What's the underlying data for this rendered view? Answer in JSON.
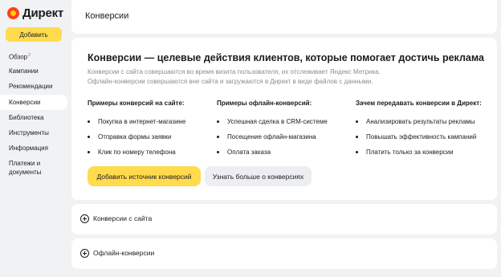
{
  "logo": {
    "text": "Директ"
  },
  "sidebar": {
    "add_button": "Добавить",
    "items": [
      {
        "label": "Обзор",
        "badge": "2"
      },
      {
        "label": "Кампании"
      },
      {
        "label": "Рекомендации"
      },
      {
        "label": "Конверсии",
        "active": true
      },
      {
        "label": "Библиотека"
      },
      {
        "label": "Инструменты"
      },
      {
        "label": "Информация"
      },
      {
        "label": "Платежи и документы"
      }
    ]
  },
  "header": {
    "title": "Конверсии"
  },
  "main": {
    "title": "Конверсии — целевые действия клиентов, которые помогает достичь реклама",
    "description_line1": "Конверсии с сайта совершаются во время визита пользователя, их отслеживает Яндекс Метрика.",
    "description_line2": "Офлайн-конверсии совершаются вне сайта и загружаются в Директ в виде файлов с данными.",
    "columns": [
      {
        "title": "Примеры конверсий на сайте:",
        "items": [
          "Покупка в интернет-магазине",
          "Отправка формы заявки",
          "Клик по номеру телефона"
        ]
      },
      {
        "title": "Примеры офлайн-конверсий:",
        "items": [
          "Успешная сделка в CRM-системе",
          "Посещение офлайн-магазина",
          "Оплата заказа"
        ]
      },
      {
        "title": "Зачем передавать конверсии в Директ:",
        "items": [
          "Анализировать результаты рекламы",
          "Повышать эффективность кампаний",
          "Платить только за конверсии"
        ]
      }
    ],
    "primary_button": "Добавить источник конверсий",
    "secondary_button": "Узнать больше о конверсиях"
  },
  "accordions": [
    {
      "label": "Конверсии с сайта"
    },
    {
      "label": "Офлайн-конверсии"
    }
  ],
  "colors": {
    "accent": "#ffdb4d",
    "badge": "#fc3f1d",
    "background": "#f1f2f4",
    "card": "#ffffff"
  }
}
